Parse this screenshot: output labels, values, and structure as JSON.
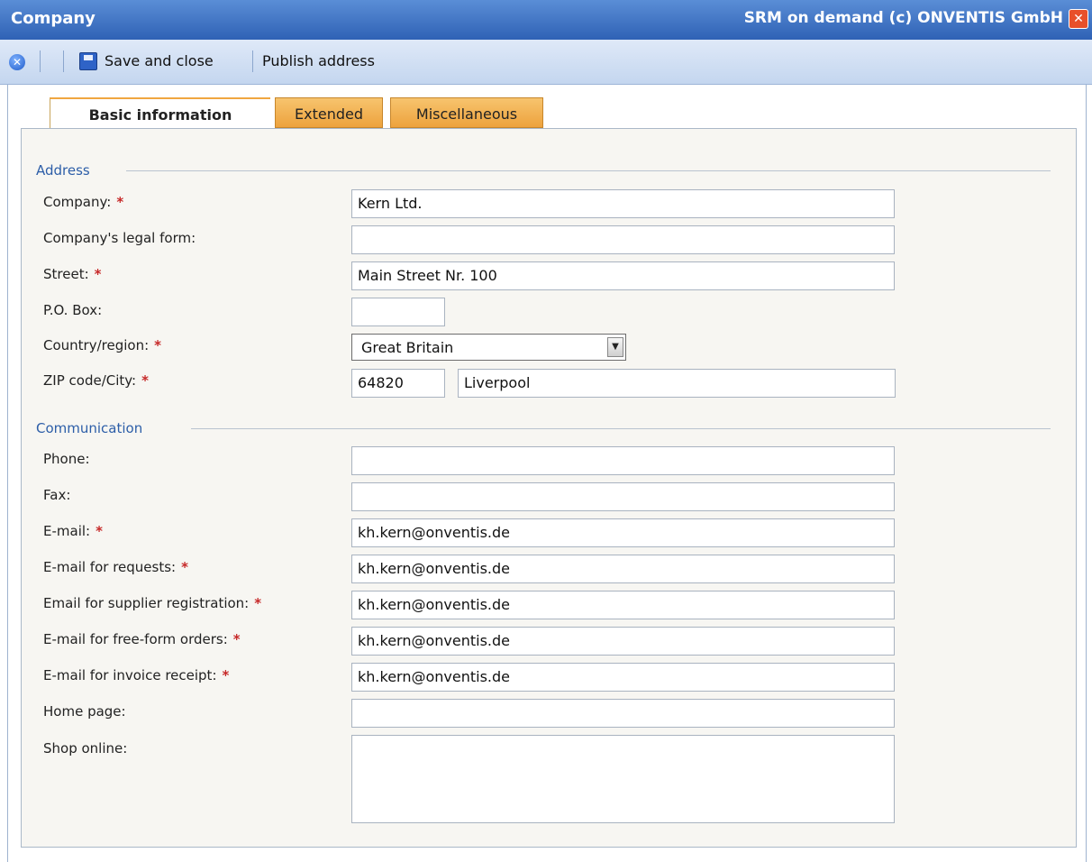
{
  "window": {
    "title": "Company",
    "brand": "SRM on demand (c) ONVENTIS GmbH",
    "close_glyph": "✕"
  },
  "toolbar": {
    "cancel_icon": "cancel-icon",
    "save_icon": "floppy-disk-icon",
    "save_label": "Save and close",
    "publish_label": "Publish address"
  },
  "tabs": [
    {
      "label": "Basic information",
      "active": true
    },
    {
      "label": "Extended",
      "active": false
    },
    {
      "label": "Miscellaneous",
      "active": false
    }
  ],
  "sections": {
    "address": "Address",
    "communication": "Communication"
  },
  "required_marker": "*",
  "fields": {
    "company": {
      "label": "Company:",
      "value": "Kern Ltd."
    },
    "legal_form": {
      "label": "Company's legal form:",
      "value": ""
    },
    "street": {
      "label": "Street:",
      "value": "Main Street Nr. 100"
    },
    "po_box": {
      "label": "P.O. Box:",
      "value": ""
    },
    "country": {
      "label": "Country/region:",
      "value": "Great Britain"
    },
    "zip_city": {
      "label": "ZIP code/City:",
      "zip": "64820",
      "city": "Liverpool"
    },
    "phone": {
      "label": "Phone:",
      "value": ""
    },
    "fax": {
      "label": "Fax:",
      "value": ""
    },
    "email": {
      "label": "E-mail:",
      "value": "kh.kern@onventis.de"
    },
    "email_requests": {
      "label": "E-mail for requests:",
      "value": "kh.kern@onventis.de"
    },
    "email_supplier_reg": {
      "label": "Email for supplier registration:",
      "value": "kh.kern@onventis.de"
    },
    "email_freeform": {
      "label": "E-mail for free-form orders:",
      "value": "kh.kern@onventis.de"
    },
    "email_invoice": {
      "label": "E-mail for invoice receipt:",
      "value": "kh.kern@onventis.de"
    },
    "home_page": {
      "label": "Home page:",
      "value": ""
    },
    "shop_online": {
      "label": "Shop online:",
      "value": ""
    }
  }
}
